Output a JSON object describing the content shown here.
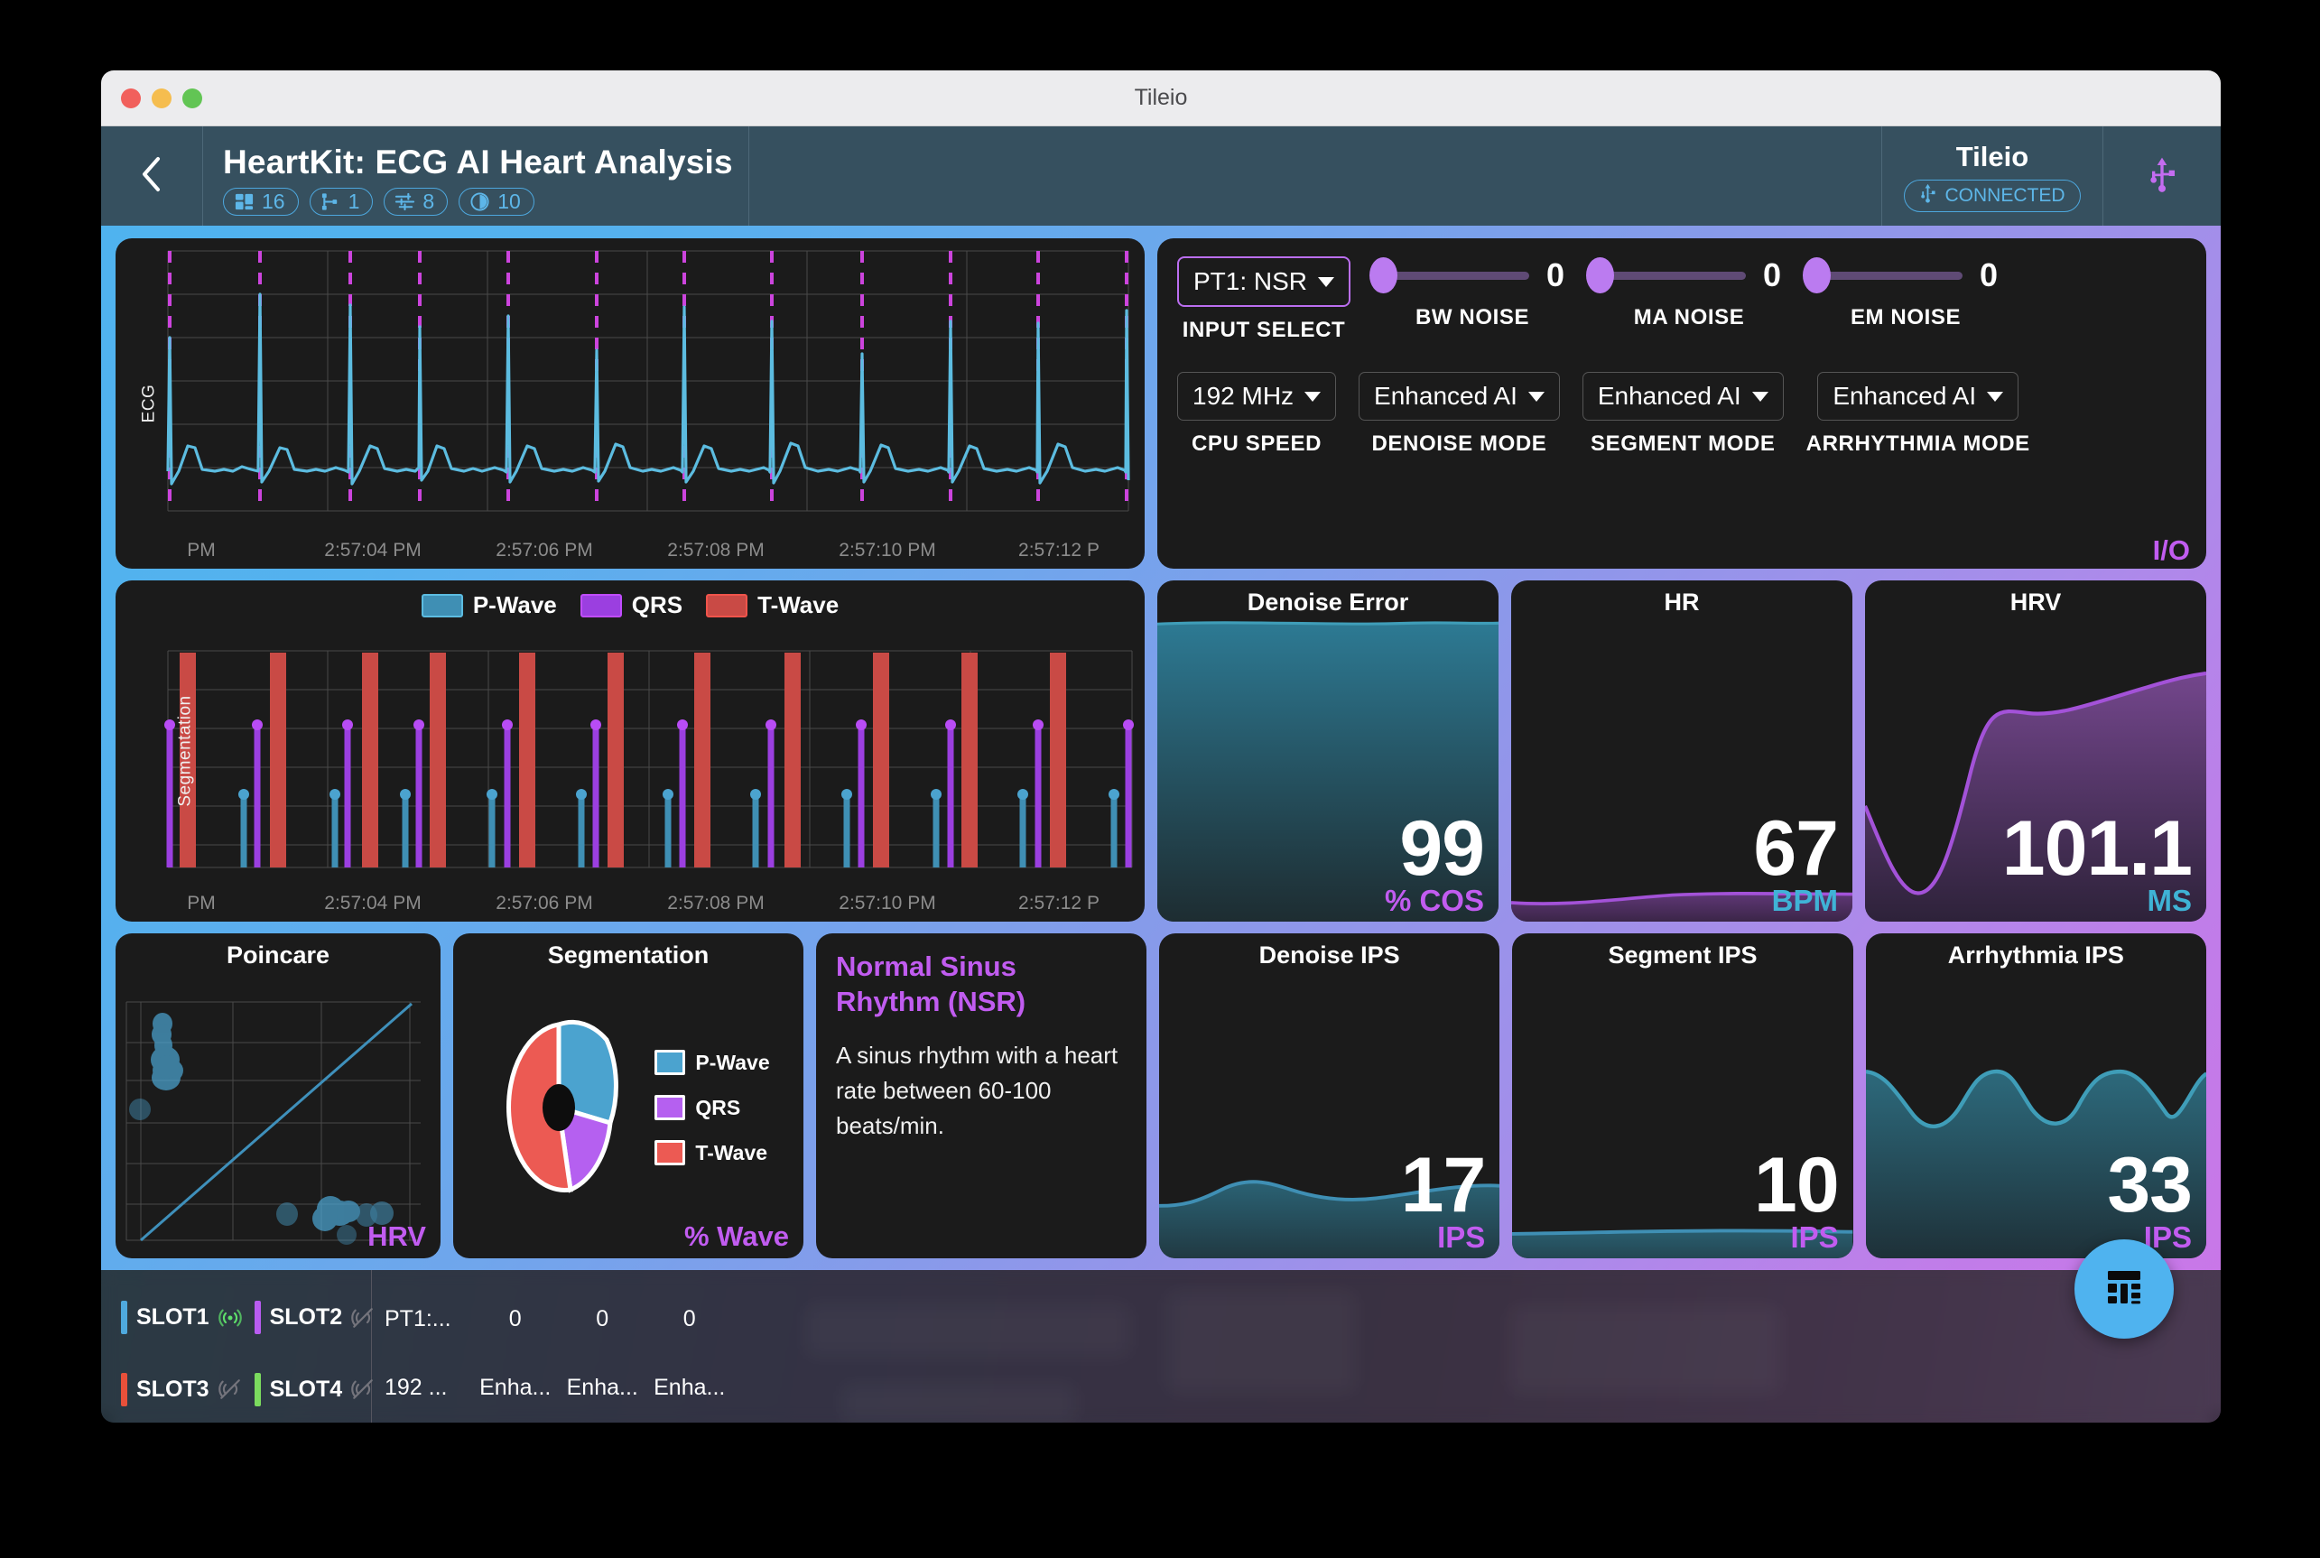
{
  "window": {
    "title": "Tileio",
    "traffic_lights": [
      "close",
      "minimize",
      "maximize"
    ]
  },
  "header": {
    "back_icon": "chevron-left-icon",
    "app_title": "HeartKit: ECG AI Heart Analysis",
    "badges": [
      {
        "icon": "dashboard-icon",
        "value": "16"
      },
      {
        "icon": "sitemap-icon",
        "value": "1"
      },
      {
        "icon": "sliders-icon",
        "value": "8"
      },
      {
        "icon": "clock-icon",
        "value": "10"
      }
    ],
    "device_name": "Tileio",
    "device_status": "CONNECTED",
    "device_status_icon": "usb-icon",
    "usb_icon": "usb-icon"
  },
  "io_panel": {
    "tag": "I/O",
    "input_select": {
      "value": "PT1: NSR",
      "label": "INPUT SELECT"
    },
    "sliders": [
      {
        "label": "BW NOISE",
        "value": "0"
      },
      {
        "label": "MA NOISE",
        "value": "0"
      },
      {
        "label": "EM NOISE",
        "value": "0"
      }
    ],
    "selects": [
      {
        "value": "192 MHz",
        "label": "CPU SPEED"
      },
      {
        "value": "Enhanced AI",
        "label": "DENOISE MODE"
      },
      {
        "value": "Enhanced AI",
        "label": "SEGMENT MODE"
      },
      {
        "value": "Enhanced AI",
        "label": "ARRHYTHMIA MODE"
      }
    ]
  },
  "ecg_chart": {
    "axis_label": "ECG",
    "xticks": [
      "PM",
      "2:57:04 PM",
      "2:57:06 PM",
      "2:57:08 PM",
      "2:57:10 PM",
      "2:57:12 P"
    ]
  },
  "segmentation_chart": {
    "axis_label": "Segmentation",
    "xticks": [
      "PM",
      "2:57:04 PM",
      "2:57:06 PM",
      "2:57:08 PM",
      "2:57:10 PM",
      "2:57:12 P"
    ],
    "legend": [
      {
        "label": "P-Wave",
        "color": "#3f8fb4"
      },
      {
        "label": "QRS",
        "color": "#9b3fe0"
      },
      {
        "label": "T-Wave",
        "color": "#e8534d"
      }
    ]
  },
  "metrics": [
    {
      "title": "Denoise Error",
      "value": "99",
      "unit": "% COS",
      "unit_color": "#c15cf0",
      "fill": "teal"
    },
    {
      "title": "HR",
      "value": "67",
      "unit": "BPM",
      "unit_color": "#3fb3d6",
      "fill": "purple"
    },
    {
      "title": "HRV",
      "value": "101.1",
      "unit": "MS",
      "unit_color": "#3fb3d6",
      "fill": "purple"
    }
  ],
  "ips_cards": [
    {
      "title": "Denoise IPS",
      "value": "17",
      "unit": "IPS",
      "unit_color": "#c15cf0"
    },
    {
      "title": "Segment IPS",
      "value": "10",
      "unit": "IPS",
      "unit_color": "#c15cf0"
    },
    {
      "title": "Arrhythmia IPS",
      "value": "33",
      "unit": "IPS",
      "unit_color": "#c15cf0"
    }
  ],
  "poincare": {
    "title": "Poincare",
    "tag": "HRV"
  },
  "segmentation_pie": {
    "title": "Segmentation",
    "tag": "% Wave",
    "legend": [
      {
        "label": "P-Wave",
        "color": "#4ba3cf"
      },
      {
        "label": "QRS",
        "color": "#b560f0"
      },
      {
        "label": "T-Wave",
        "color": "#ec5a53"
      }
    ]
  },
  "diagnosis": {
    "title": "Normal Sinus Rhythm (NSR)",
    "body": "A sinus rhythm with a heart rate between 60-100 beats/min."
  },
  "bottom_bar": {
    "slots": [
      {
        "name": "SLOT1",
        "color": "#4fa9dd",
        "icon": "signal-on-icon",
        "active": true
      },
      {
        "name": "SLOT2",
        "color": "#b85cf0",
        "icon": "signal-off-icon",
        "active": false
      },
      {
        "name": "SLOT3",
        "color": "#e8503a",
        "icon": "signal-off-icon",
        "active": false
      },
      {
        "name": "SLOT4",
        "color": "#7bdb5e",
        "icon": "signal-off-icon",
        "active": false
      }
    ],
    "values_row1": [
      "PT1:...",
      "0",
      "0",
      "0"
    ],
    "values_row2": [
      "192 ...",
      "Enha...",
      "Enha...",
      "Enha..."
    ]
  },
  "fab": {
    "icon": "dashboard-icon"
  },
  "chart_data": [
    {
      "type": "line",
      "name": "ecg-waveform",
      "title": "ECG",
      "xlabel": "",
      "ylabel": "ECG",
      "xtick_labels": [
        "PM",
        "2:57:04 PM",
        "2:57:06 PM",
        "2:57:08 PM",
        "2:57:10 PM",
        "2:57:12 P"
      ],
      "grid": true,
      "series": [
        {
          "name": "ECG",
          "color": "#5cbce0"
        }
      ],
      "annotations": {
        "qrs_markers_color": "#cc44dd",
        "qrs_marker_count": 13,
        "note": "vertical magenta dashed lines marking detected QRS complexes"
      }
    },
    {
      "type": "bar",
      "name": "segmentation-timeline",
      "title": "Segmentation",
      "ylabel": "Segmentation",
      "xtick_labels": [
        "PM",
        "2:57:04 PM",
        "2:57:06 PM",
        "2:57:08 PM",
        "2:57:10 PM",
        "2:57:12 P"
      ],
      "grid": true,
      "series": [
        {
          "name": "P-Wave",
          "color": "#3f8fb4",
          "level": 0.33
        },
        {
          "name": "QRS",
          "color": "#9b3fe0",
          "level": 0.7
        },
        {
          "name": "T-Wave",
          "color": "#c94a45",
          "level": 1.0
        }
      ],
      "beat_count": 12
    },
    {
      "type": "pie",
      "name": "segmentation-wave-distribution",
      "title": "Segmentation",
      "unit": "% Wave",
      "labels": [
        "P-Wave",
        "QRS",
        "T-Wave"
      ],
      "values": [
        26,
        24,
        50
      ],
      "colors": [
        "#4ba3cf",
        "#b560f0",
        "#ec5a53"
      ]
    },
    {
      "type": "scatter",
      "name": "poincare-plot",
      "title": "Poincare",
      "unit": "HRV",
      "grid": true,
      "identity_line": true,
      "points": [
        [
          0.11,
          0.86
        ],
        [
          0.12,
          0.8
        ],
        [
          0.115,
          0.74
        ],
        [
          0.13,
          0.67
        ],
        [
          0.12,
          0.63
        ],
        [
          0.14,
          0.61
        ],
        [
          0.125,
          0.58
        ],
        [
          0.03,
          0.5
        ],
        [
          0.58,
          0.14
        ],
        [
          0.7,
          0.16
        ],
        [
          0.74,
          0.18
        ],
        [
          0.72,
          0.13
        ],
        [
          0.8,
          0.15
        ],
        [
          0.85,
          0.16
        ],
        [
          0.79,
          0.09
        ]
      ],
      "color": "#4ba3cf"
    },
    {
      "type": "area",
      "name": "denoise-error-sparkline",
      "title": "Denoise Error",
      "value": 99,
      "unit": "% COS",
      "color": "#3f8fb4"
    },
    {
      "type": "area",
      "name": "hr-sparkline",
      "title": "HR",
      "value": 67,
      "unit": "BPM",
      "color": "#a352d8"
    },
    {
      "type": "area",
      "name": "hrv-sparkline",
      "title": "HRV",
      "value": 101.1,
      "unit": "MS",
      "color": "#a352d8"
    },
    {
      "type": "area",
      "name": "denoise-ips-sparkline",
      "title": "Denoise IPS",
      "value": 17,
      "unit": "IPS",
      "color": "#3f8fb4"
    },
    {
      "type": "area",
      "name": "segment-ips-sparkline",
      "title": "Segment IPS",
      "value": 10,
      "unit": "IPS",
      "color": "#3f8fb4"
    },
    {
      "type": "area",
      "name": "arrhythmia-ips-sparkline",
      "title": "Arrhythmia IPS",
      "value": 33,
      "unit": "IPS",
      "color": "#3f8fb4"
    }
  ]
}
